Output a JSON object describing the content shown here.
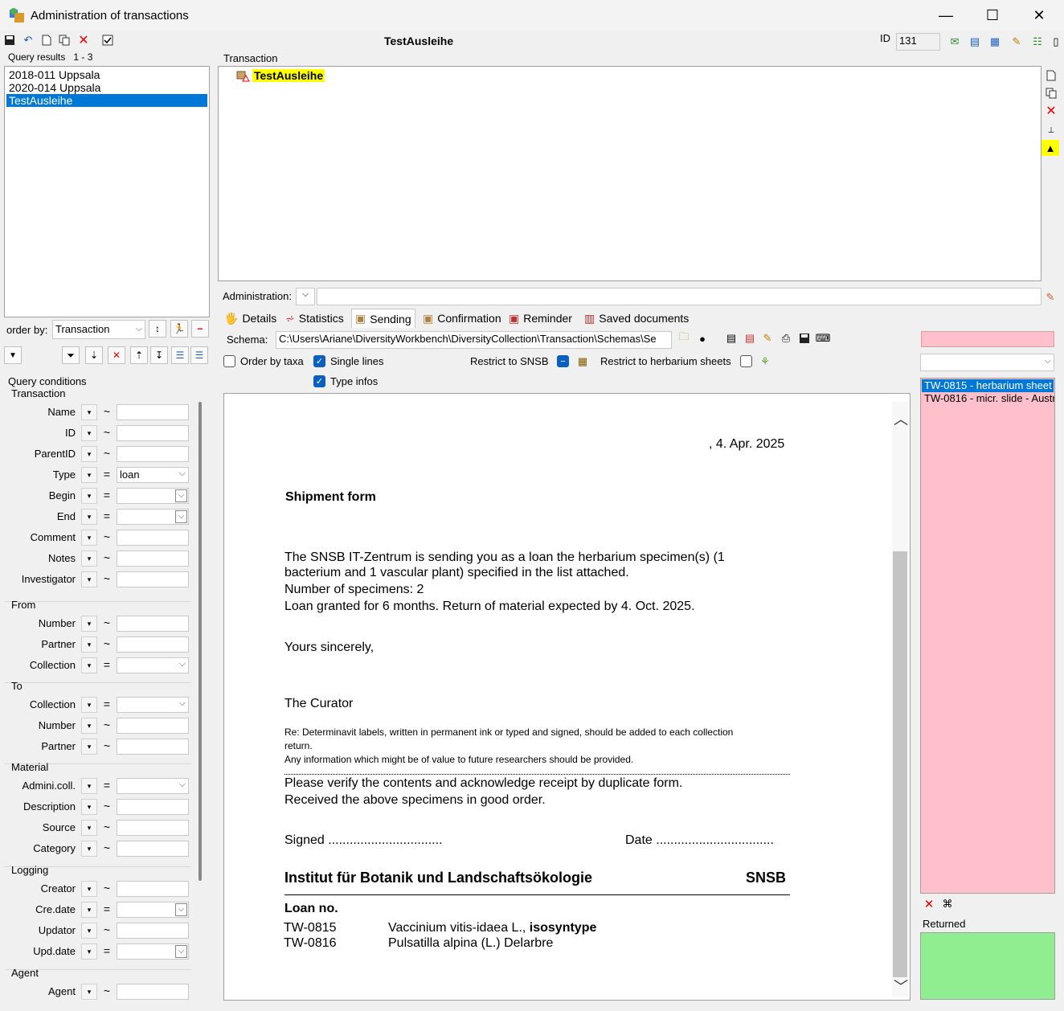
{
  "window": {
    "title": "Administration of transactions",
    "minimize": "—",
    "maximize": "☐",
    "close": "✕"
  },
  "header": {
    "current_transaction": "TestAusleihe",
    "id_label": "ID",
    "id_value": "131"
  },
  "query_results": {
    "label": "Query results",
    "count": "1 - 3",
    "items": [
      "2018-011 Uppsala",
      "2020-014 Uppsala",
      "TestAusleihe"
    ],
    "selected_index": 2
  },
  "order_by": {
    "label": "order by:",
    "value": "Transaction"
  },
  "query_conditions": {
    "label": "Query conditions",
    "groups": {
      "transaction": "Transaction",
      "from": "From",
      "to": "To",
      "material": "Material",
      "logging": "Logging",
      "agent": "Agent"
    },
    "rows": [
      {
        "label": "Name",
        "op": "~",
        "value": ""
      },
      {
        "label": "ID",
        "op": "~",
        "value": ""
      },
      {
        "label": "ParentID",
        "op": "~",
        "value": ""
      },
      {
        "label": "Type",
        "op": "=",
        "value": "loan"
      },
      {
        "label": "Begin",
        "op": "=",
        "value": ""
      },
      {
        "label": "End",
        "op": "=",
        "value": ""
      },
      {
        "label": "Comment",
        "op": "~",
        "value": ""
      },
      {
        "label": "Notes",
        "op": "~",
        "value": ""
      },
      {
        "label": "Investigator",
        "op": "~",
        "value": ""
      },
      {
        "label": "Number",
        "op": "~",
        "value": ""
      },
      {
        "label": "Partner",
        "op": "~",
        "value": ""
      },
      {
        "label": "Collection",
        "op": "=",
        "value": ""
      },
      {
        "label": "Collection",
        "op": "=",
        "value": ""
      },
      {
        "label": "Number",
        "op": "~",
        "value": ""
      },
      {
        "label": "Partner",
        "op": "~",
        "value": ""
      },
      {
        "label": "Admini.coll.",
        "op": "=",
        "value": ""
      },
      {
        "label": "Description",
        "op": "~",
        "value": ""
      },
      {
        "label": "Source",
        "op": "~",
        "value": ""
      },
      {
        "label": "Category",
        "op": "~",
        "value": ""
      },
      {
        "label": "Creator",
        "op": "~",
        "value": ""
      },
      {
        "label": "Cre.date",
        "op": "=",
        "value": ""
      },
      {
        "label": "Updator",
        "op": "~",
        "value": ""
      },
      {
        "label": "Upd.date",
        "op": "=",
        "value": ""
      },
      {
        "label": "Agent",
        "op": "~",
        "value": ""
      }
    ]
  },
  "transaction_tree": {
    "label": "Transaction",
    "node": "TestAusleihe"
  },
  "administration": {
    "label": "Administration:",
    "value": ""
  },
  "tabs": [
    {
      "label": "Details"
    },
    {
      "label": "Statistics"
    },
    {
      "label": "Sending"
    },
    {
      "label": "Confirmation"
    },
    {
      "label": "Reminder"
    },
    {
      "label": "Saved documents"
    }
  ],
  "sending": {
    "schema_label": "Schema:",
    "schema_path": "C:\\Users\\Ariane\\DiversityWorkbench\\DiversityCollection\\Transaction\\Schemas\\Se",
    "order_by_taxa": "Order by taxa",
    "single_lines": "Single lines",
    "type_infos": "Type infos",
    "restrict_snsb": "Restrict to SNSB",
    "restrict_herbarium": "Restrict to herbarium sheets"
  },
  "document": {
    "date": ", 4. Apr. 2025",
    "heading": "Shipment form",
    "body1": "The SNSB IT-Zentrum is sending you as a loan the herbarium specimen(s) (1",
    "body2": "bacterium and 1 vascular plant) specified in the list attached.",
    "body3": "Number of specimens: 2",
    "body4": "Loan granted for 6 months. Return of material expected by 4. Oct. 2025.",
    "closing": "Yours sincerely,",
    "signature": "The Curator",
    "note1": "Re: Determinavit labels, written in permanent ink or typed and signed, should be added to each collection",
    "note2": "return.",
    "note3": "Any information which might be of value to future researchers should be provided.",
    "verify1": "Please verify the contents and acknowledge receipt by duplicate form.",
    "verify2": "Received the above specimens in good order.",
    "signed": "Signed ................................",
    "date_line": "Date .................................",
    "institute": "Institut für Botanik und Landschaftsökologie",
    "institute_short": "SNSB",
    "loan_no": "Loan no.",
    "loans": [
      {
        "no": "TW-0815",
        "taxon": "Vaccinium vitis-idaea L., ",
        "type": "isosyntype"
      },
      {
        "no": "TW-0816",
        "taxon": "Pulsatilla alpina (L.) Delarbre",
        "type": ""
      }
    ]
  },
  "specimen_list": {
    "items": [
      "TW-0815 - herbarium sheet",
      "TW-0816 - micr. slide - Austr"
    ],
    "selected_index": 0,
    "returned_label": "Returned"
  },
  "colors": {
    "selection": "#0078d7",
    "highlight": "#ffff00",
    "pending": "#ffc0cb",
    "returned": "#90ee90"
  }
}
